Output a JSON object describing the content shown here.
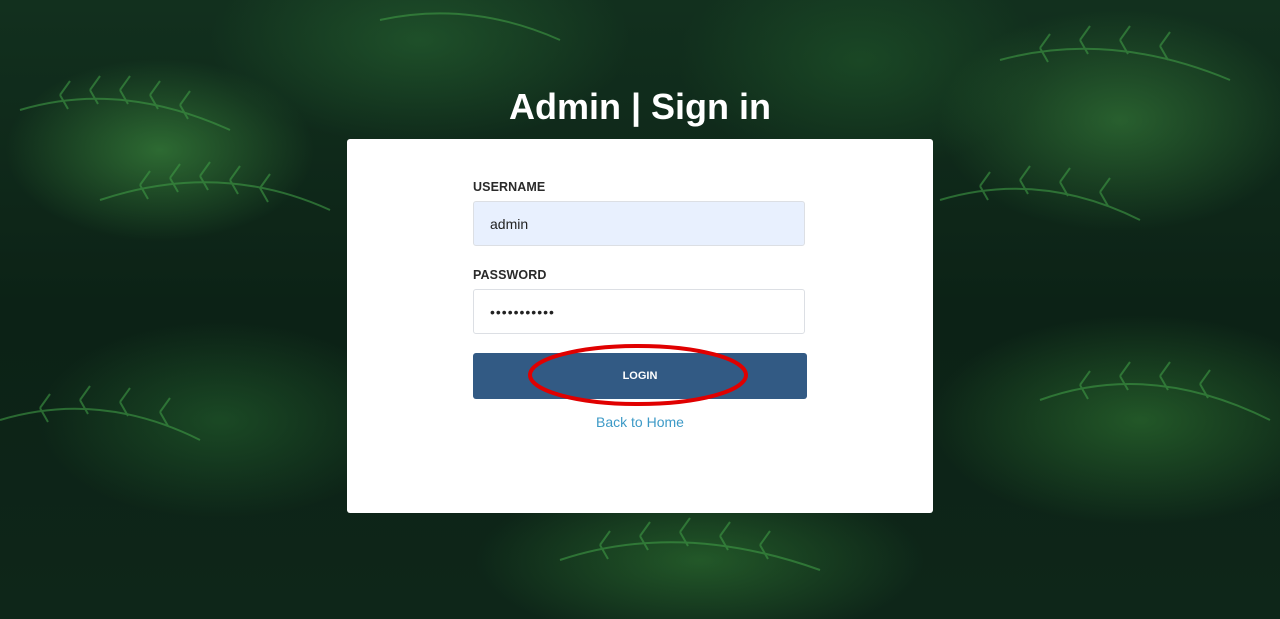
{
  "page": {
    "title": "Admin | Sign in"
  },
  "form": {
    "username_label": "USERNAME",
    "username_value": "admin",
    "password_label": "PASSWORD",
    "password_value": "password123",
    "login_label": "LOGIN",
    "back_link": "Back to Home"
  },
  "colors": {
    "button": "#325a84",
    "link": "#3d9ac7",
    "annotation": "#e00000",
    "autofill": "#e8f0fe"
  }
}
